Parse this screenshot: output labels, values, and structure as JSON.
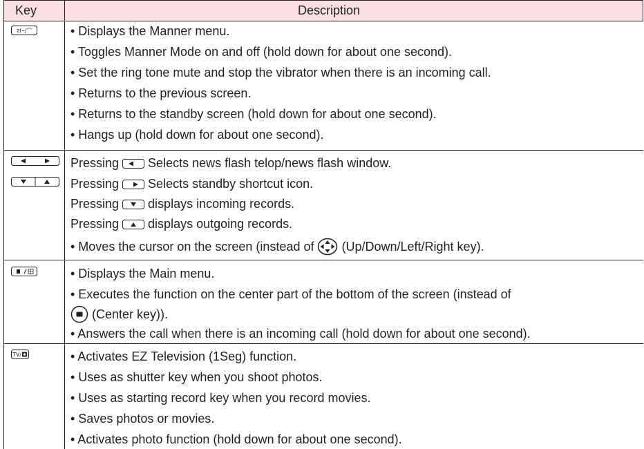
{
  "header": {
    "key": "Key",
    "description": "Description"
  },
  "rows": [
    {
      "key_icon": "manner-key-icon",
      "key_text": "ﾏﾅｰ/⌒",
      "lines": [
        "• Displays the Manner menu.",
        "• Toggles Manner Mode on and off (hold down for about one second).",
        "• Set the ring tone mute and stop the vibrator when there is an incoming call.",
        "• Returns to the previous screen.",
        "• Returns to the standby screen (hold down for about one second).",
        "• Hangs up (hold down for about one second)."
      ]
    },
    {
      "key_icon": "side-keys-icon",
      "lines": [
        {
          "pre": "Pressing ",
          "icon": "left-key-icon",
          "post": " Selects news flash telop/news flash window."
        },
        {
          "pre": "Pressing ",
          "icon": "right-key-icon",
          "post": " Selects standby shortcut icon."
        },
        {
          "pre": "Pressing ",
          "icon": "down-key-icon",
          "post": " displays incoming records."
        },
        {
          "pre": "Pressing ",
          "icon": "up-key-icon",
          "post": " displays outgoing records."
        },
        {
          "pre": "• Moves the cursor on the screen (instead of ",
          "icon": "multi-direction-key-icon",
          "post": " (Up/Down/Left/Right key)."
        }
      ]
    },
    {
      "key_icon": "center-menu-key-icon",
      "lines": [
        "• Displays the Main menu.",
        "• Executes the function on the center part of the bottom of the screen (instead of",
        {
          "pre": "",
          "icon": "center-key-icon",
          "post": " (Center key))."
        },
        "• Answers the call when there is an incoming call (hold down for about one second)."
      ]
    },
    {
      "key_icon": "tv-camera-key-icon",
      "key_text": "TV/",
      "lines": [
        "• Activates EZ Television (1Seg) function.",
        "• Uses as shutter key when you shoot photos.",
        "• Uses as starting record key when you record movies.",
        "• Saves photos or movies.",
        "• Activates photo function (hold down for about one second)."
      ]
    }
  ]
}
